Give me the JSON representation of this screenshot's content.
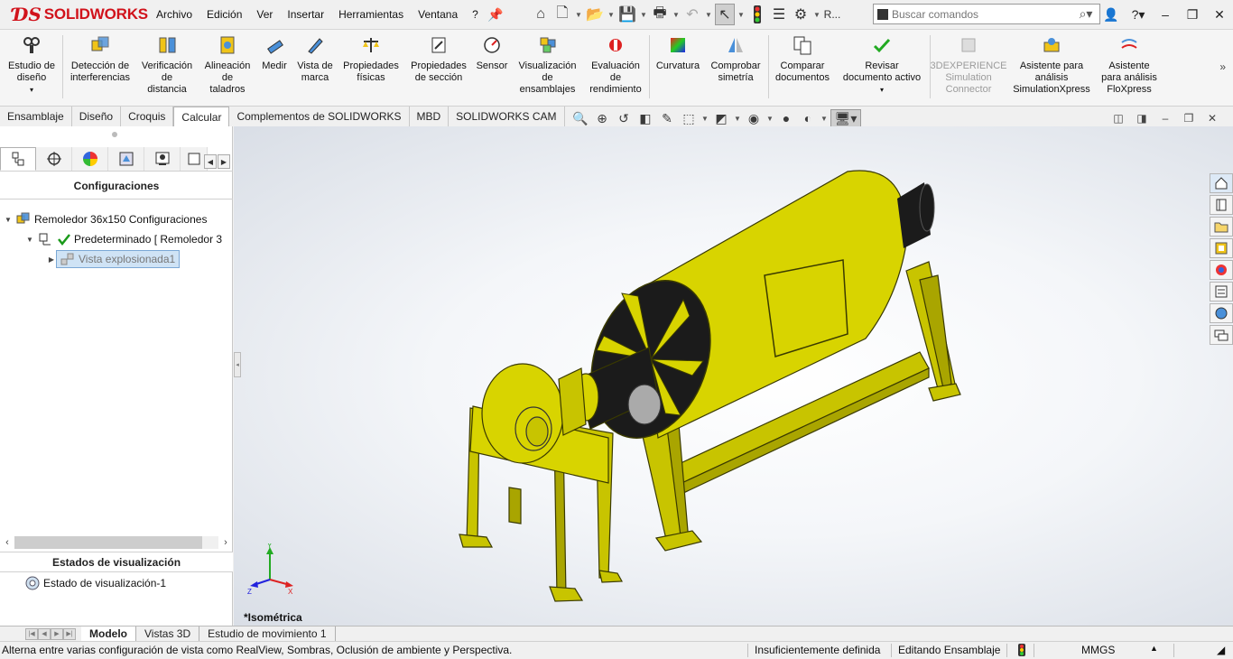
{
  "app": {
    "brand": "SOLIDWORKS",
    "menu": [
      "Archivo",
      "Edición",
      "Ver",
      "Insertar",
      "Herramientas",
      "Ventana",
      "?"
    ],
    "search_placeholder": "Buscar comandos",
    "overflow_label": "R..."
  },
  "ribbon": {
    "buttons": [
      {
        "id": "estudio",
        "label": "Estudio de\ndiseño",
        "icon": "design-study-icon"
      },
      {
        "id": "deteccion",
        "label": "Detección de\ninterferencias",
        "icon": "interference-icon"
      },
      {
        "id": "verificacion",
        "label": "Verificación\nde\ndistancia",
        "icon": "clearance-icon"
      },
      {
        "id": "alineacion",
        "label": "Alineación\nde\ntaladros",
        "icon": "hole-alignment-icon"
      },
      {
        "id": "medir",
        "label": "Medir",
        "icon": "measure-icon"
      },
      {
        "id": "vista",
        "label": "Vista de\nmarca",
        "icon": "markup-icon"
      },
      {
        "id": "propfis",
        "label": "Propiedades\nfísicas",
        "icon": "mass-properties-icon"
      },
      {
        "id": "propsec",
        "label": "Propiedades\nde sección",
        "icon": "section-properties-icon"
      },
      {
        "id": "sensor",
        "label": "Sensor",
        "icon": "sensor-icon"
      },
      {
        "id": "visual",
        "label": "Visualización\nde\nensamblajes",
        "icon": "assembly-visualization-icon"
      },
      {
        "id": "evaluacion",
        "label": "Evaluación\nde\nrendimiento",
        "icon": "performance-icon"
      },
      {
        "id": "curvatura",
        "label": "Curvatura",
        "icon": "curvature-icon"
      },
      {
        "id": "simetria",
        "label": "Comprobar\nsimetría",
        "icon": "symmetry-icon"
      },
      {
        "id": "comparar",
        "label": "Comparar\ndocumentos",
        "icon": "compare-icon"
      },
      {
        "id": "revisar",
        "label": "Revisar\ndocumento activo",
        "icon": "design-checker-icon"
      },
      {
        "id": "experience",
        "label": "3DEXPERIENCE\nSimulation\nConnector",
        "icon": "simulation-connector-icon"
      },
      {
        "id": "simxpress",
        "label": "Asistente para\nanálisis\nSimulationXpress",
        "icon": "simulationxpress-icon"
      },
      {
        "id": "floxpress",
        "label": "Asistente\npara análisis\nFloXpress",
        "icon": "floxpress-icon"
      }
    ]
  },
  "command_tabs": [
    "Ensamblaje",
    "Diseño",
    "Croquis",
    "Calcular",
    "Complementos de SOLIDWORKS",
    "MBD",
    "SOLIDWORKS CAM"
  ],
  "active_command_tab": "Calcular",
  "manager": {
    "title": "Configuraciones",
    "tree": [
      {
        "label": "Remoledor 36x150 Configuraciones"
      },
      {
        "label": "Predeterminado [ Remoledor 3"
      },
      {
        "label": "Vista explosionada1"
      }
    ],
    "display_title": "Estados de visualización",
    "display_state": "Estado de visualización-1"
  },
  "viewport": {
    "view_name": "*Isométrica",
    "model_color": "#d8d400"
  },
  "bottom_tabs": [
    "Modelo",
    "Vistas 3D",
    "Estudio de movimiento 1"
  ],
  "status": {
    "message": "Alterna entre varias configuración de vista como RealView, Sombras, Oclusión de ambiente y Perspectiva.",
    "definition": "Insuficientemente definida",
    "mode": "Editando Ensamblaje",
    "units": "MMGS"
  }
}
